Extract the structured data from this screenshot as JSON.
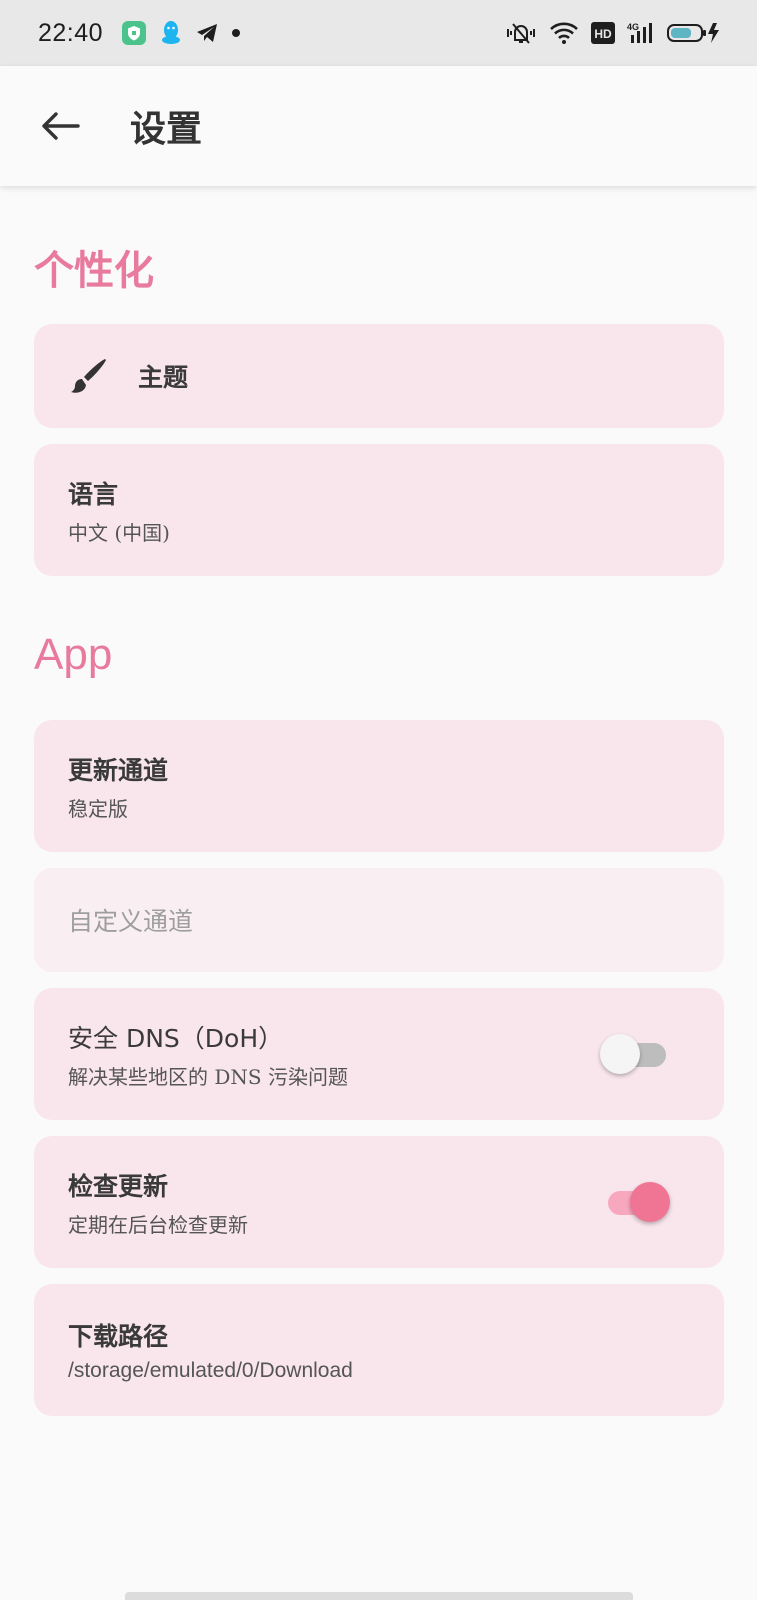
{
  "status_bar": {
    "time": "22:40",
    "left_icons": [
      "shield-app-icon",
      "qq-icon",
      "telegram-icon",
      "dot-icon"
    ],
    "right_icons": [
      "vibrate-mute-icon",
      "wifi-icon",
      "hd-icon",
      "signal-4g-icon",
      "battery-charging-icon"
    ],
    "hd_label": "HD",
    "network_label": "4G"
  },
  "app_bar": {
    "title": "设置",
    "back_icon": "arrow-left-icon"
  },
  "sections": {
    "personalization": {
      "header": "个性化",
      "theme": {
        "title": "主题",
        "icon": "brush-icon"
      },
      "language": {
        "title": "语言",
        "subtitle": "中文 (中国)"
      }
    },
    "app": {
      "header": "App",
      "update_channel": {
        "title": "更新通道",
        "subtitle": "稳定版"
      },
      "custom_channel": {
        "title": "自定义通道",
        "enabled": false
      },
      "secure_dns": {
        "title": "安全 DNS（DoH）",
        "subtitle": "解决某些地区的 DNS 污染问题",
        "checked": false
      },
      "check_updates": {
        "title": "检查更新",
        "subtitle": "定期在后台检查更新",
        "checked": true
      },
      "download_path": {
        "title": "下载路径",
        "subtitle": "/storage/emulated/0/Download"
      }
    }
  },
  "colors": {
    "accent": "#e87a9e",
    "card_bg": "#f9e6ec",
    "switch_on_thumb": "#f07595",
    "switch_on_track": "#f7a8bf"
  }
}
